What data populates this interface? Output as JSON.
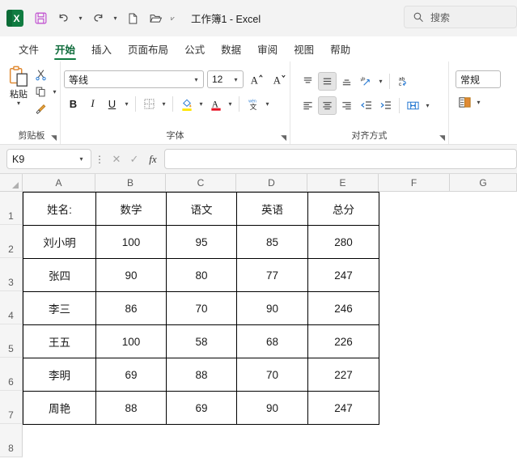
{
  "titlebar": {
    "app_icon": "excel-logo",
    "logo_letter": "X",
    "window_title": "工作簿1  -  Excel",
    "qat": [
      {
        "name": "save-button",
        "icon": "save-icon"
      },
      {
        "name": "undo-button",
        "icon": "undo-icon"
      },
      {
        "name": "undo-dropdown",
        "icon": "chevron-down-icon"
      },
      {
        "name": "redo-button",
        "icon": "redo-icon"
      },
      {
        "name": "redo-dropdown",
        "icon": "chevron-down-icon"
      },
      {
        "name": "new-file-button",
        "icon": "new-file-icon"
      },
      {
        "name": "open-file-button",
        "icon": "open-folder-icon"
      },
      {
        "name": "customize-quick-access-toolbar",
        "icon": "chevron-down-icon"
      }
    ]
  },
  "search": {
    "placeholder": "搜索",
    "icon": "search-icon"
  },
  "tabs": [
    {
      "label": "文件",
      "active": false
    },
    {
      "label": "开始",
      "active": true
    },
    {
      "label": "插入",
      "active": false
    },
    {
      "label": "页面布局",
      "active": false
    },
    {
      "label": "公式",
      "active": false
    },
    {
      "label": "数据",
      "active": false
    },
    {
      "label": "审阅",
      "active": false
    },
    {
      "label": "视图",
      "active": false
    },
    {
      "label": "帮助",
      "active": false
    }
  ],
  "ribbon": {
    "clipboard": {
      "group_label": "剪贴板",
      "paste_label": "粘贴",
      "cut_label": "剪切",
      "copy_label": "复制",
      "format_painter_label": "格式刷"
    },
    "font": {
      "group_label": "字体",
      "font_name": "等线",
      "font_size": "12",
      "grow_font": "A",
      "shrink_font": "A",
      "bold": "B",
      "italic": "I",
      "underline": "U",
      "phonetic": "文"
    },
    "alignment": {
      "group_label": "对齐方式"
    },
    "number": {
      "format_value": "常规"
    }
  },
  "formula_bar": {
    "name_box_value": "K9",
    "cancel_icon": "close-icon",
    "enter_icon": "check-icon",
    "function_label": "fx",
    "formula_value": ""
  },
  "grid": {
    "columns": [
      "A",
      "B",
      "C",
      "D",
      "E",
      "F",
      "G"
    ],
    "rows": [
      "1",
      "2",
      "3",
      "4",
      "5",
      "6",
      "7",
      "8"
    ]
  },
  "sheet_data": {
    "headers": [
      "姓名:",
      "数学",
      "语文",
      "英语",
      "总分"
    ],
    "rows": [
      [
        "刘小明",
        "100",
        "95",
        "85",
        "280"
      ],
      [
        "张四",
        "90",
        "80",
        "77",
        "247"
      ],
      [
        "李三",
        "86",
        "70",
        "90",
        "246"
      ],
      [
        "王五",
        "100",
        "58",
        "68",
        "226"
      ],
      [
        "李明",
        "69",
        "88",
        "70",
        "227"
      ],
      [
        "周艳",
        "88",
        "69",
        "90",
        "247"
      ]
    ]
  },
  "colors": {
    "excel_green": "#107c41",
    "accent_underline": "#107c41",
    "save_purple": "#c050d0",
    "highlight_yellow": "#ffe600",
    "font_red": "#e81123",
    "paste_orange": "#e08a33"
  }
}
